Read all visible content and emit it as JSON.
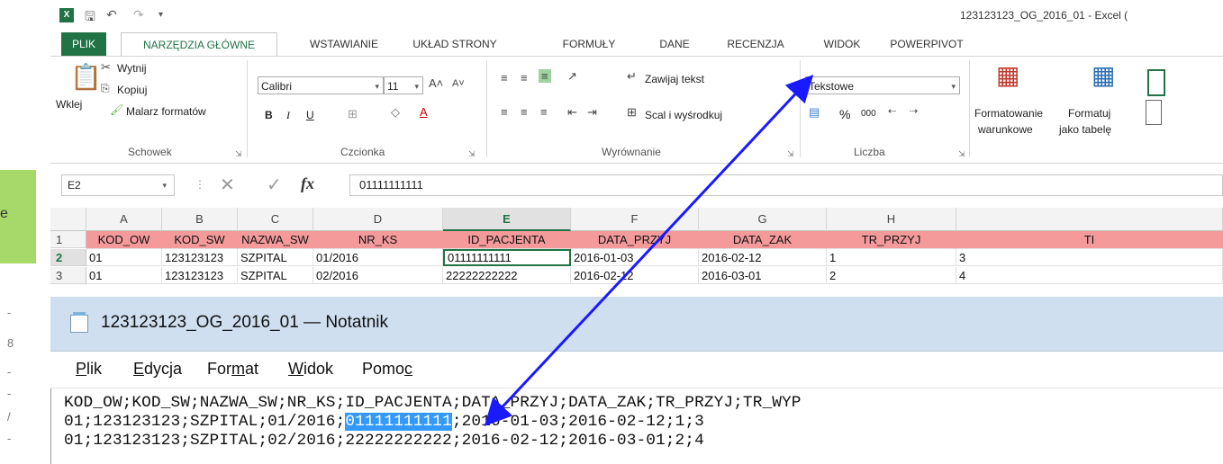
{
  "left_panel": {
    "label": "e",
    "ruler_marks": [
      "-",
      "8",
      "-",
      "-",
      "/",
      "-"
    ]
  },
  "excel": {
    "title": "123123123_OG_2016_01 - Excel (",
    "logo": "X",
    "tabs": [
      "PLIK",
      "NARZĘDZIA GŁÓWNE",
      "WSTAWIANIE",
      "UKŁAD STRONY",
      "FORMUŁY",
      "DANE",
      "RECENZJA",
      "WIDOK",
      "POWERPIVOT"
    ],
    "ribbon": {
      "clipboard": {
        "paste": "Wklej",
        "cut": "Wytnij",
        "copy": "Kopiuj",
        "format_painter": "Malarz formatów",
        "label": "Schowek"
      },
      "font": {
        "name": "Calibri",
        "size": "11",
        "bold": "B",
        "italic": "I",
        "underline": "U",
        "label": "Czcionka"
      },
      "alignment": {
        "wrap": "Zawijaj tekst",
        "merge": "Scal i wyśrodkuj",
        "label": "Wyrównanie"
      },
      "number": {
        "format": "Tekstowe",
        "percent": "%",
        "thousands": "000",
        "label": "Liczba"
      },
      "styles": {
        "conditional_1": "Formatowanie",
        "conditional_2": "warunkowe",
        "table_1": "Formatuj",
        "table_2": "jako tabelę"
      }
    },
    "name_box": "E2",
    "fx": "fx",
    "formula": "01111111111",
    "columns": [
      "A",
      "B",
      "C",
      "D",
      "E",
      "F",
      "G",
      "H"
    ],
    "rows": [
      {
        "num": "1",
        "cells": [
          "KOD_OW",
          "KOD_SW",
          "NAZWA_SW",
          "NR_KS",
          "ID_PACJENTA",
          "DATA_PRZYJ",
          "DATA_ZAK",
          "TR_PRZYJ",
          "TI"
        ]
      },
      {
        "num": "2",
        "cells": [
          "01",
          "123123123",
          "SZPITAL",
          "01/2016",
          "01111111111",
          "2016-01-03",
          "2016-02-12",
          "1",
          "3"
        ]
      },
      {
        "num": "3",
        "cells": [
          "01",
          "123123123",
          "SZPITAL",
          "02/2016",
          "22222222222",
          "2016-02-12",
          "2016-03-01",
          "2",
          "4"
        ]
      }
    ]
  },
  "notepad": {
    "title": "123123123_OG_2016_01 — Notatnik",
    "menu": [
      {
        "u": "P",
        "rest": "lik"
      },
      {
        "u": "E",
        "rest": "dycja"
      },
      {
        "pre": "For",
        "u": "m",
        "rest": "at"
      },
      {
        "u": "W",
        "rest": "idok"
      },
      {
        "pre": "Pomo",
        "u": "c",
        "rest": ""
      }
    ],
    "line1": "KOD_OW;KOD_SW;NAZWA_SW;NR_KS;ID_PACJENTA;DATA_PRZYJ;DATA_ZAK;TR_PRZYJ;TR_WYP",
    "line2_pre": "01;123123123;SZPITAL;01/2016;",
    "line2_hl": "01111111111",
    "line2_post": ";2016-01-03;2016-02-12;1;3",
    "line3": "01;123123123;SZPITAL;02/2016;22222222222;2016-02-12;2016-03-01;2;4"
  },
  "colors": {
    "excel_green": "#217346",
    "header_fill": "#f49a9a",
    "arrow": "#1a1aff",
    "selection": "#3399ff"
  }
}
